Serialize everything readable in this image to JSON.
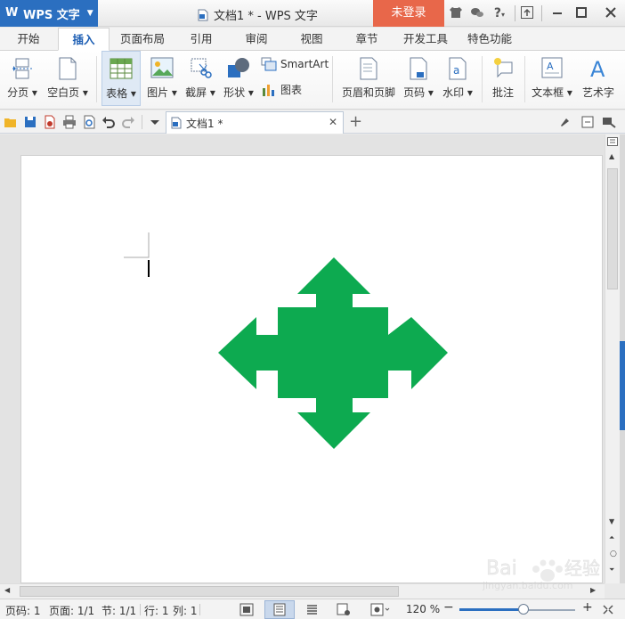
{
  "app": {
    "name": "WPS 文字",
    "logo_letter": "W",
    "document_title": "文档1 * - WPS 文字",
    "login_label": "未登录",
    "help_label": "?"
  },
  "tabs": [
    {
      "label": "开始"
    },
    {
      "label": "插入",
      "active": true
    },
    {
      "label": "页面布局"
    },
    {
      "label": "引用"
    },
    {
      "label": "审阅"
    },
    {
      "label": "视图"
    },
    {
      "label": "章节"
    },
    {
      "label": "开发工具"
    },
    {
      "label": "特色功能"
    }
  ],
  "ribbon": {
    "page_break": "分页",
    "blank_page": "空白页",
    "table": "表格",
    "picture": "图片",
    "screenshot": "截屏",
    "shapes": "形状",
    "smartart": "SmartArt",
    "chart": "图表",
    "header_footer": "页眉和页脚",
    "page_number": "页码",
    "watermark": "水印",
    "comment": "批注",
    "text_box": "文本框",
    "word_art": "艺术字"
  },
  "document_tab": {
    "label": "文档1 *"
  },
  "shape": {
    "type": "four-way-arrow",
    "fill": "#0daa50"
  },
  "statusbar": {
    "page_no": "页码: 1",
    "pages": "页面: 1/1",
    "section": "节: 1/1",
    "row": "行: 1",
    "column": "列: 1",
    "zoom_label": "120 %",
    "zoom_fraction": 0.55
  },
  "watermark_text": {
    "brand": "Bai",
    "brand2": "经验",
    "url": "jingyan.baidu.com"
  },
  "colors": {
    "accent": "#2b6fc0",
    "login": "#e8674a",
    "shape": "#0daa50"
  }
}
